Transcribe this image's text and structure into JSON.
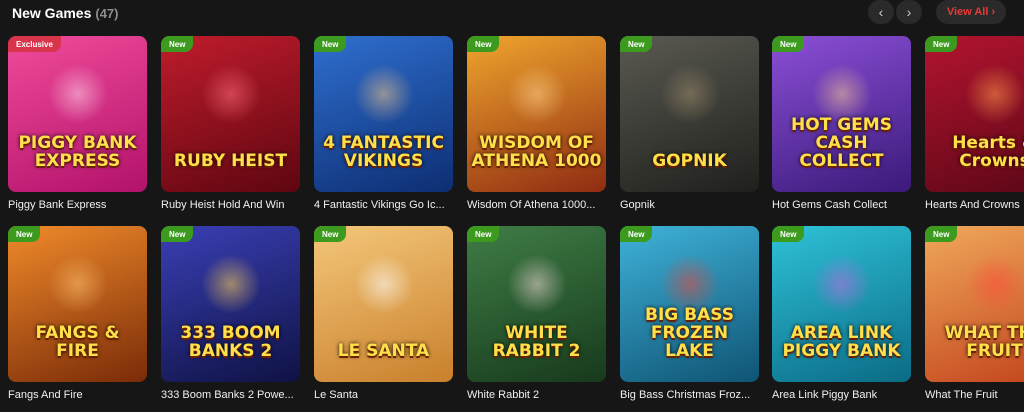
{
  "header": {
    "title": "New Games",
    "count": "(47)",
    "prev_icon": "‹",
    "next_icon": "›",
    "view_all": "View All ›"
  },
  "games": [
    {
      "name": "Piggy Bank Express",
      "badge": "Exclusive",
      "badge_type": "exclusive",
      "logo": "PIGGY BANK EXPRESS",
      "colors": [
        "#f04b9b",
        "#b3126a"
      ],
      "art": "#ffd2e8"
    },
    {
      "name": "Ruby Heist Hold And Win",
      "badge": "New",
      "badge_type": "new",
      "logo": "RUBY HEIST",
      "colors": [
        "#c01c2c",
        "#5e0610"
      ],
      "art": "#ff6d7a"
    },
    {
      "name": "4 Fantastic Vikings Go Ic...",
      "badge": "New",
      "badge_type": "new",
      "logo": "4 FANTASTIC VIKINGS",
      "colors": [
        "#2f6fd0",
        "#0d2e72"
      ],
      "art": "#f0c48b"
    },
    {
      "name": "Wisdom Of Athena 1000...",
      "badge": "New",
      "badge_type": "new",
      "logo": "WISDOM OF ATHENA 1000",
      "colors": [
        "#f0a52d",
        "#8f2c12"
      ],
      "art": "#ffd28a"
    },
    {
      "name": "Gopnik",
      "badge": "New",
      "badge_type": "new",
      "logo": "GOPNIK",
      "colors": [
        "#5a5a52",
        "#1f1f1c"
      ],
      "art": "#9c8b6a"
    },
    {
      "name": "Hot Gems Cash Collect",
      "badge": "New",
      "badge_type": "new",
      "logo": "HOT GEMS CASH COLLECT",
      "colors": [
        "#8b4fd6",
        "#3a1a7a"
      ],
      "art": "#f3c79a"
    },
    {
      "name": "Hearts And Crowns",
      "badge": "New",
      "badge_type": "new",
      "logo": "Hearts & Crowns",
      "colors": [
        "#b3142f",
        "#5a0716"
      ],
      "art": "#ff9a4a"
    },
    {
      "name": "Fangs And Fire",
      "badge": "New",
      "badge_type": "new",
      "logo": "FANGS & FIRE",
      "colors": [
        "#f08a2a",
        "#7a2b08"
      ],
      "art": "#ffc170"
    },
    {
      "name": "333 Boom Banks 2 Powe...",
      "badge": "New",
      "badge_type": "new",
      "logo": "333 BOOM BANKS 2",
      "colors": [
        "#3a3fb5",
        "#0f1244"
      ],
      "art": "#ffd35a"
    },
    {
      "name": "Le Santa",
      "badge": "New",
      "badge_type": "new",
      "logo": "LE SANTA",
      "colors": [
        "#f4c77a",
        "#c9802c"
      ],
      "art": "#ffffff"
    },
    {
      "name": "White Rabbit 2",
      "badge": "New",
      "badge_type": "new",
      "logo": "WHITE RABBIT 2",
      "colors": [
        "#3f7d46",
        "#173a1c"
      ],
      "art": "#f2dada"
    },
    {
      "name": "Big Bass Christmas Froz...",
      "badge": "New",
      "badge_type": "new",
      "logo": "BIG BASS FROZEN LAKE",
      "colors": [
        "#3fb2d9",
        "#0f5474"
      ],
      "art": "#e8483a"
    },
    {
      "name": "Area Link Piggy Bank",
      "badge": "New",
      "badge_type": "new",
      "logo": "AREA LINK PIGGY BANK",
      "colors": [
        "#2ec2d8",
        "#0b6b86"
      ],
      "art": "#c06ae0"
    },
    {
      "name": "What The Fruit",
      "badge": "New",
      "badge_type": "new",
      "logo": "WHAT THE FRUIT",
      "colors": [
        "#f0a85a",
        "#c2421c"
      ],
      "art": "#ff4a3a"
    }
  ]
}
